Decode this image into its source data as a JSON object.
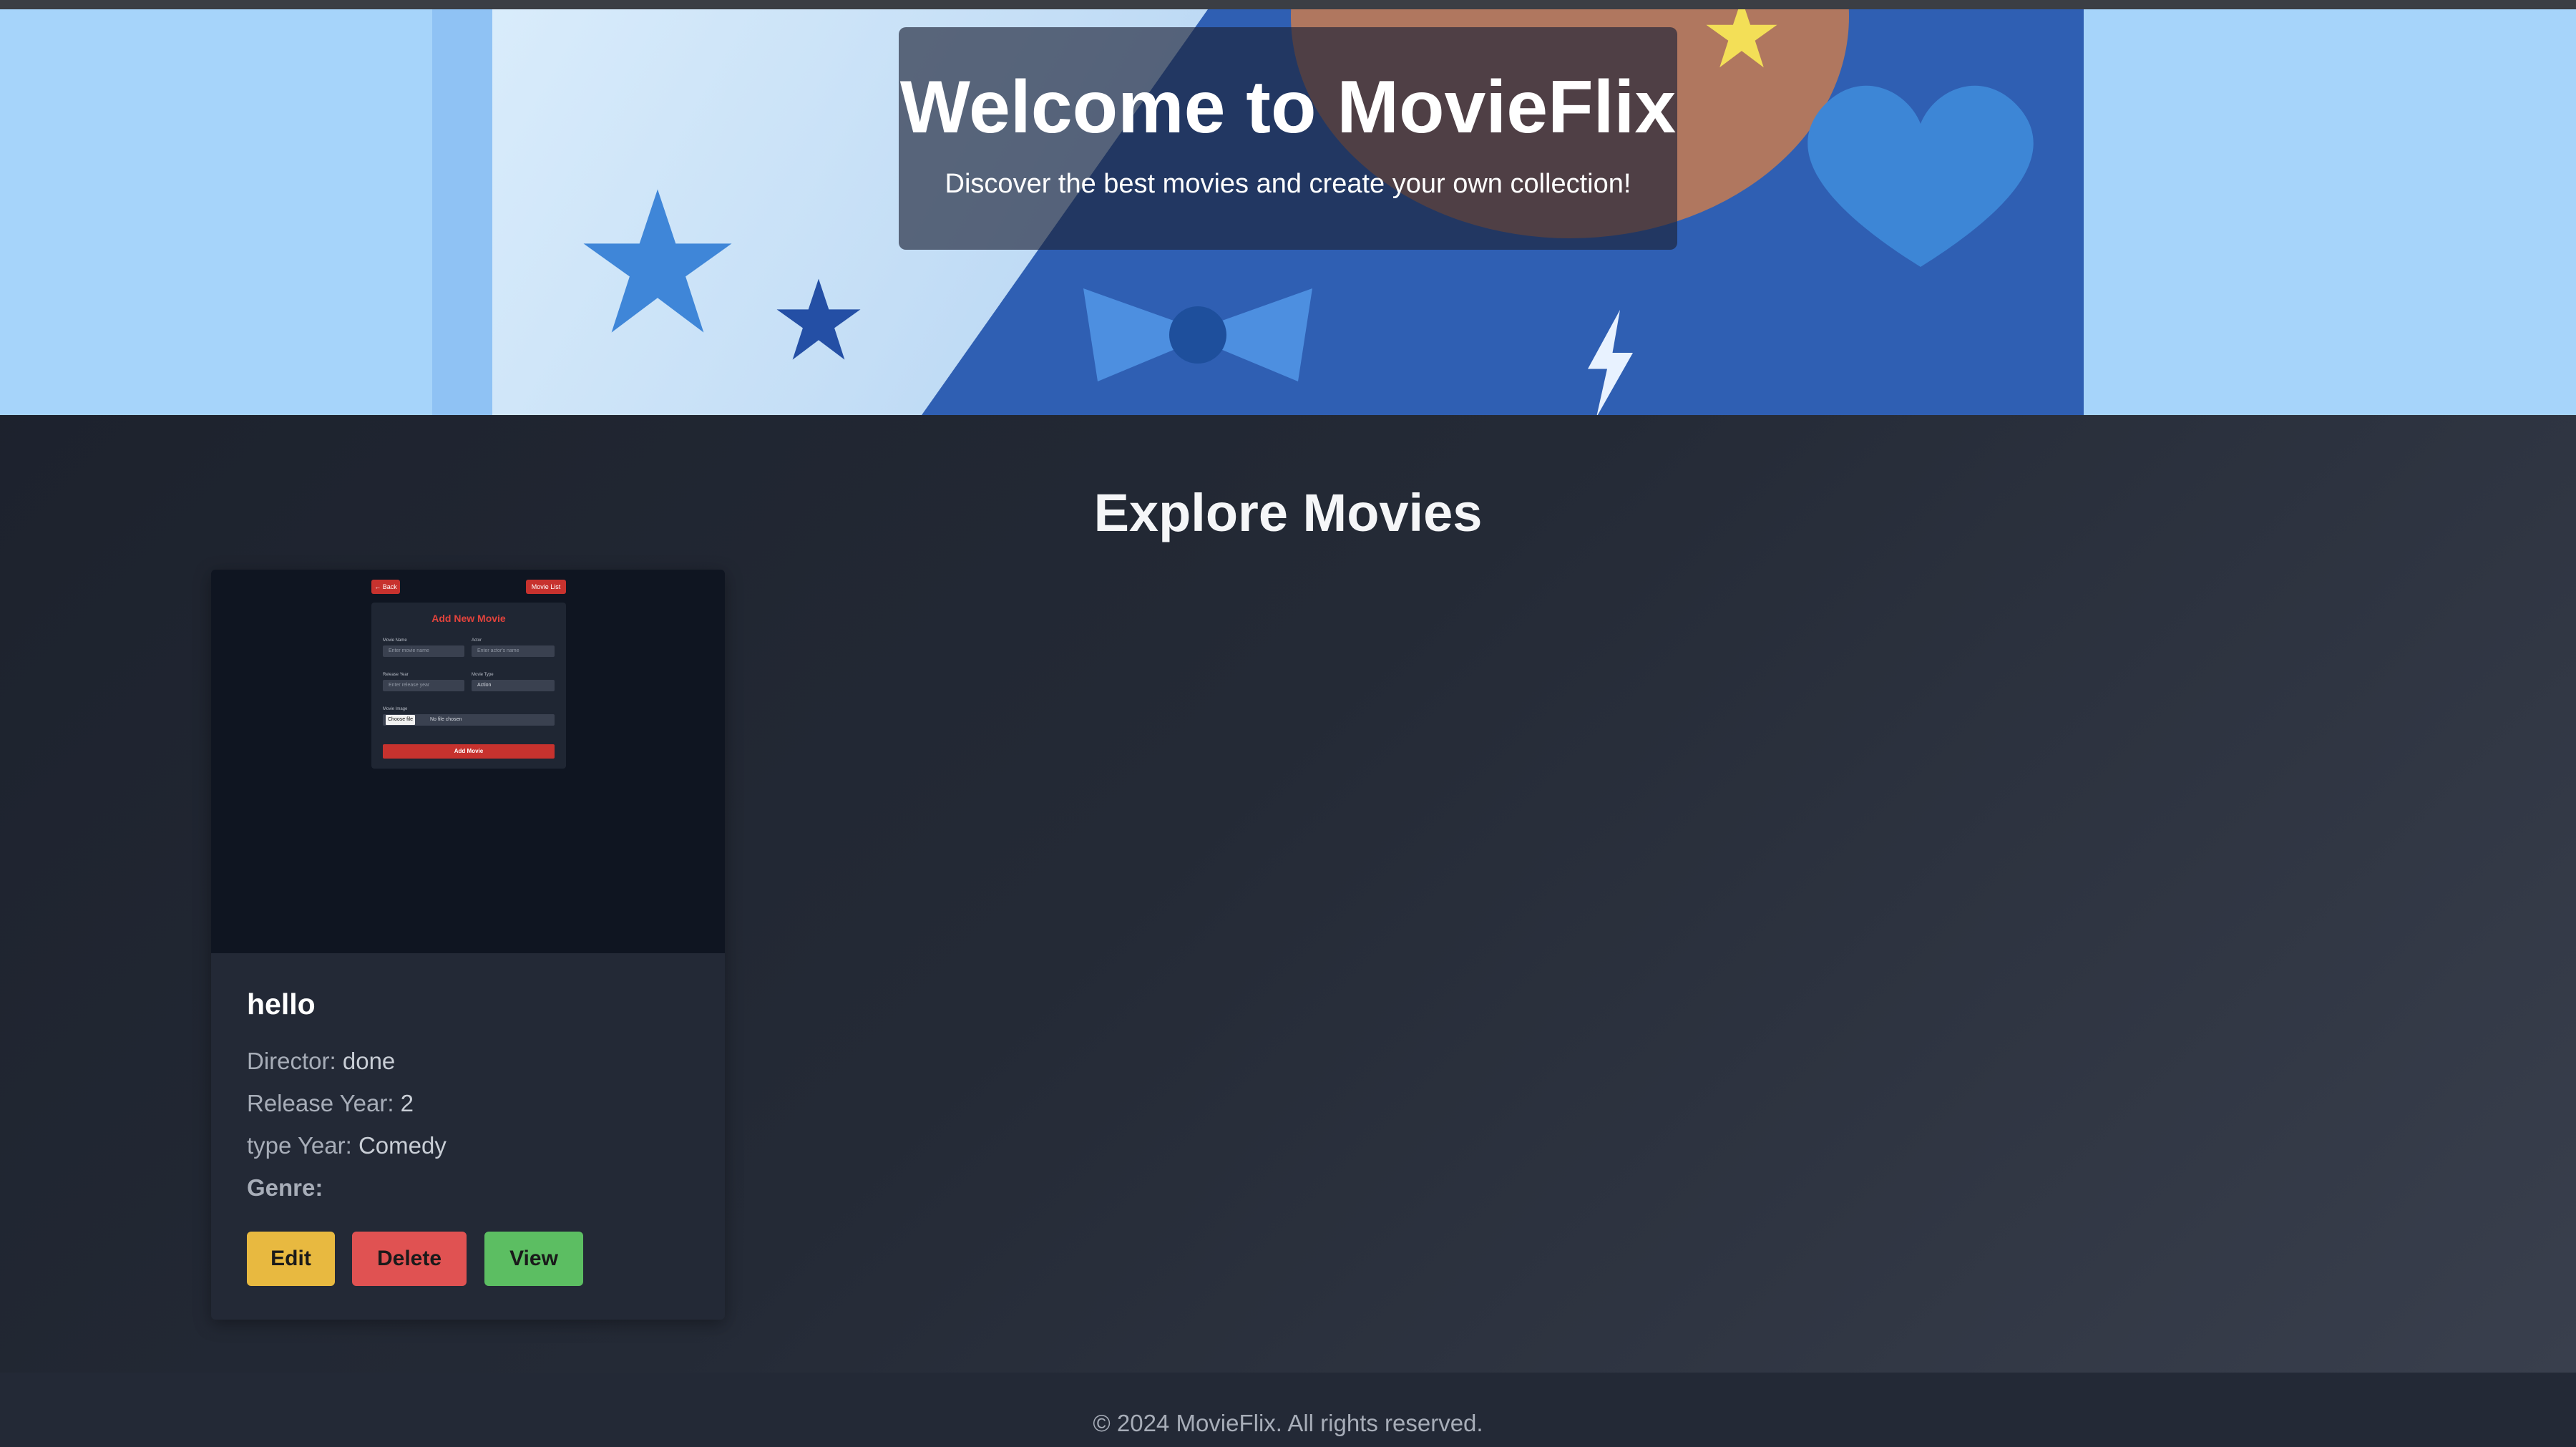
{
  "hero": {
    "title": "Welcome to MovieFlix",
    "subtitle": "Discover the best movies and create your own collection!"
  },
  "section": {
    "title": "Explore Movies"
  },
  "movies": [
    {
      "thumbnail": {
        "back_label": "← Back",
        "list_label": "Movie List",
        "form_title": "Add New Movie",
        "movie_name_label": "Movie Name",
        "movie_name_placeholder": "Enter movie name",
        "actor_label": "Actor",
        "actor_placeholder": "Enter actor's name",
        "release_year_label": "Release Year",
        "release_year_placeholder": "Enter release year",
        "movie_type_label": "Movie Type",
        "movie_type_value": "Action",
        "movie_image_label": "Movie Image",
        "choose_file_label": "Choose file",
        "no_file_text": "No file chosen",
        "add_button_label": "Add Movie"
      },
      "title": "hello",
      "director_label": "Director:",
      "director": "done",
      "release_year_label": "Release Year:",
      "release_year": "2",
      "type_label": "type Year:",
      "type": "Comedy",
      "genre_label": "Genre:",
      "genre": "",
      "actions": {
        "edit": "Edit",
        "delete": "Delete",
        "view": "View"
      }
    }
  ],
  "colors": {
    "edit": "#e8b940",
    "delete": "#e05252",
    "view": "#5cbe62",
    "hero_bg": "#a6d4fa",
    "page_bg": "#1b202b"
  },
  "footer": {
    "text": "© 2024 MovieFlix. All rights reserved."
  }
}
